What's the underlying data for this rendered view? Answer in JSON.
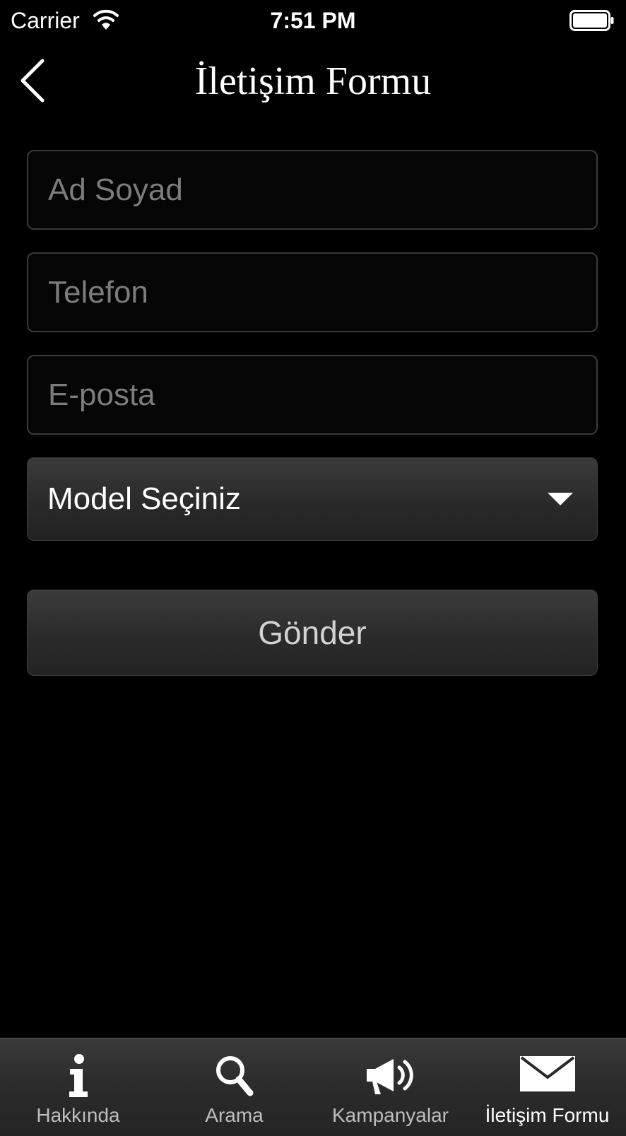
{
  "status_bar": {
    "carrier": "Carrier",
    "time": "7:51 PM",
    "wifi_icon": "wifi-icon",
    "battery_icon": "battery-icon"
  },
  "nav": {
    "back_icon": "chevron-left-icon",
    "title": "İletişim Formu"
  },
  "form": {
    "name": {
      "placeholder": "Ad Soyad",
      "value": ""
    },
    "phone": {
      "placeholder": "Telefon",
      "value": ""
    },
    "email": {
      "placeholder": "E-posta",
      "value": ""
    },
    "model_select": {
      "label": "Model Seçiniz",
      "icon": "caret-down-icon"
    },
    "submit_label": "Gönder"
  },
  "tab_bar": {
    "items": [
      {
        "label": "Hakkında",
        "icon": "info-icon",
        "active": false
      },
      {
        "label": "Arama",
        "icon": "search-icon",
        "active": false
      },
      {
        "label": "Kampanyalar",
        "icon": "megaphone-icon",
        "active": false
      },
      {
        "label": "İletişim Formu",
        "icon": "envelope-icon",
        "active": true
      }
    ]
  },
  "colors": {
    "background": "#000000",
    "text": "#ffffff",
    "placeholder": "#7c7c7c",
    "field_border": "#3a3a3a",
    "button_text": "#d2d2d2",
    "tab_inactive_text": "#bdbdbd"
  }
}
